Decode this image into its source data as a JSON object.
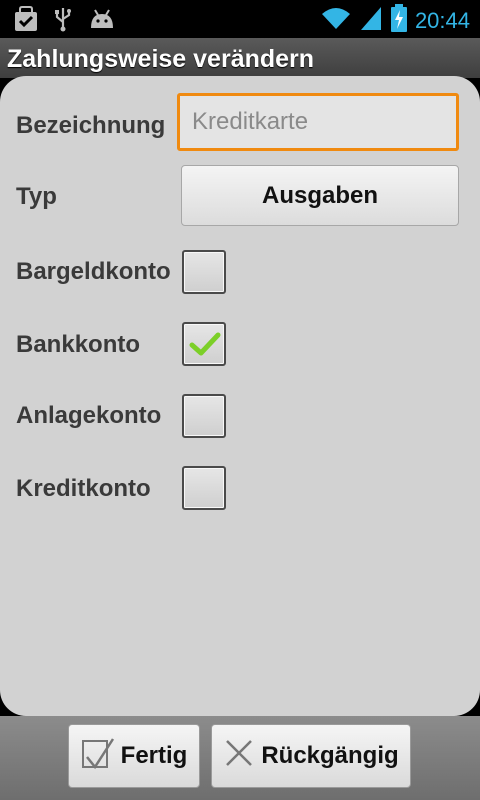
{
  "status_bar": {
    "time": "20:44",
    "icons": [
      "task-check-icon",
      "usb-icon",
      "android-icon",
      "wifi-icon",
      "signal-icon",
      "battery-charging-icon"
    ]
  },
  "dialog": {
    "title": "Zahlungsweise verändern",
    "fields": {
      "name_label": "Bezeichnung",
      "name_placeholder": "Kreditkarte",
      "type_label": "Typ",
      "type_value": "Ausgaben"
    },
    "checkboxes": [
      {
        "label": "Bargeldkonto",
        "checked": false
      },
      {
        "label": "Bankkonto",
        "checked": true
      },
      {
        "label": "Anlagekonto",
        "checked": false
      },
      {
        "label": "Kreditkonto",
        "checked": false
      }
    ]
  },
  "buttons": {
    "done": "Fertig",
    "undo": "Rückgängig"
  },
  "colors": {
    "focus_border": "#f08a10",
    "checkmark": "#7ccf28",
    "time": "#33b5e5"
  }
}
